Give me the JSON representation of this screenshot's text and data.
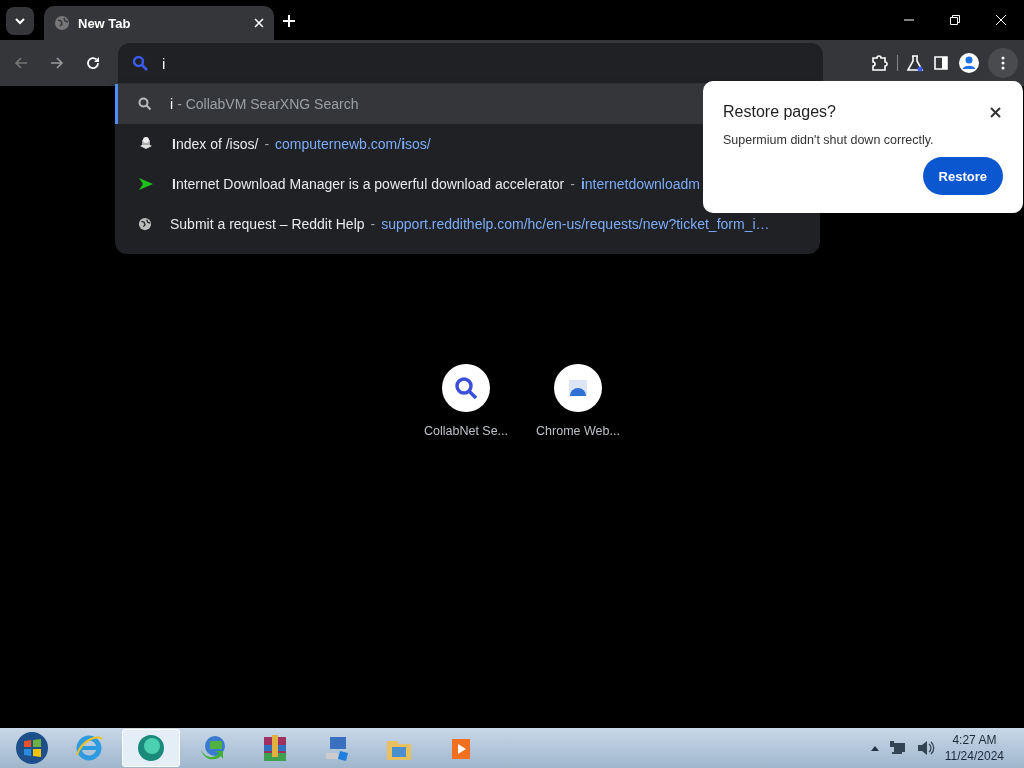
{
  "tabs": [
    {
      "title": "New Tab",
      "selected": true
    }
  ],
  "omnibox": {
    "value": "i"
  },
  "suggestions": [
    {
      "kind": "search",
      "query": "i",
      "description": "- CollabVM SearXNG Search",
      "selected": true
    },
    {
      "kind": "stack",
      "title": "**I**ndex of /isos/",
      "separator": "-",
      "url": "computernewb.com/**i**sos/",
      "selected": false
    },
    {
      "kind": "flag",
      "title": "**I**nternet Download Manager is a powerful download accelerator",
      "separator": "-",
      "url": "**i**nternetdownloadm",
      "selected": false
    },
    {
      "kind": "globe",
      "title": "Submit a request – Reddit Help",
      "separator": "-",
      "url": "support.reddithelp.com/hc/en-us/requests/new?ticket_form_i…",
      "selected": false
    }
  ],
  "restore_bubble": {
    "title": "Restore pages?",
    "message": "Supermium didn't shut down correctly.",
    "button": "Restore"
  },
  "shortcuts": [
    {
      "kind": "search",
      "label": "CollabNet Se..."
    },
    {
      "kind": "store",
      "label": "Chrome Web..."
    }
  ],
  "taskbar": {
    "apps": [
      {
        "kind": "ie",
        "selected": false
      },
      {
        "kind": "browser",
        "selected": true
      },
      {
        "kind": "download",
        "selected": false
      },
      {
        "kind": "archive",
        "selected": false
      },
      {
        "kind": "network",
        "selected": false
      },
      {
        "kind": "folder",
        "selected": false
      },
      {
        "kind": "media",
        "selected": false
      }
    ],
    "time": "4:27 AM",
    "date": "11/24/2024"
  }
}
